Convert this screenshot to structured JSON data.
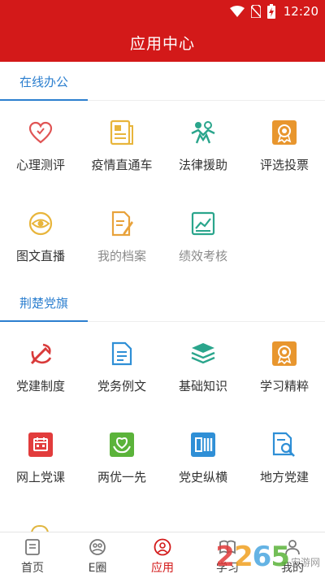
{
  "status": {
    "time": "12:20"
  },
  "header": {
    "title": "应用中心"
  },
  "sections": [
    {
      "title": "在线办公",
      "items": [
        {
          "label": "心理测评",
          "icon": "hearts-icon"
        },
        {
          "label": "疫情直通车",
          "icon": "document-icon"
        },
        {
          "label": "法律援助",
          "icon": "people-help-icon"
        },
        {
          "label": "评选投票",
          "icon": "award-icon"
        },
        {
          "label": "图文直播",
          "icon": "eye-icon"
        },
        {
          "label": "我的档案",
          "icon": "edit-file-icon"
        },
        {
          "label": "绩效考核",
          "icon": "chart-icon"
        }
      ]
    },
    {
      "title": "荆楚党旗",
      "items": [
        {
          "label": "党建制度",
          "icon": "party-emblem-icon"
        },
        {
          "label": "党务例文",
          "icon": "article-icon"
        },
        {
          "label": "基础知识",
          "icon": "books-icon"
        },
        {
          "label": "学习精粹",
          "icon": "award-icon"
        },
        {
          "label": "网上党课",
          "icon": "calendar-icon"
        },
        {
          "label": "两优一先",
          "icon": "hands-icon"
        },
        {
          "label": "党史纵横",
          "icon": "history-icon"
        },
        {
          "label": "地方党建",
          "icon": "search-doc-icon"
        }
      ]
    }
  ],
  "tabs": [
    {
      "label": "首页",
      "icon": "home-icon"
    },
    {
      "label": "E圈",
      "icon": "circle-icon"
    },
    {
      "label": "应用",
      "icon": "app-icon",
      "active": true
    },
    {
      "label": "学习",
      "icon": "book-icon"
    },
    {
      "label": "我的",
      "icon": "user-icon"
    }
  ],
  "watermark": {
    "number": "2265",
    "text": "安游网"
  },
  "colors": {
    "brand": "#d31919",
    "accent": "#2c7fcf"
  }
}
